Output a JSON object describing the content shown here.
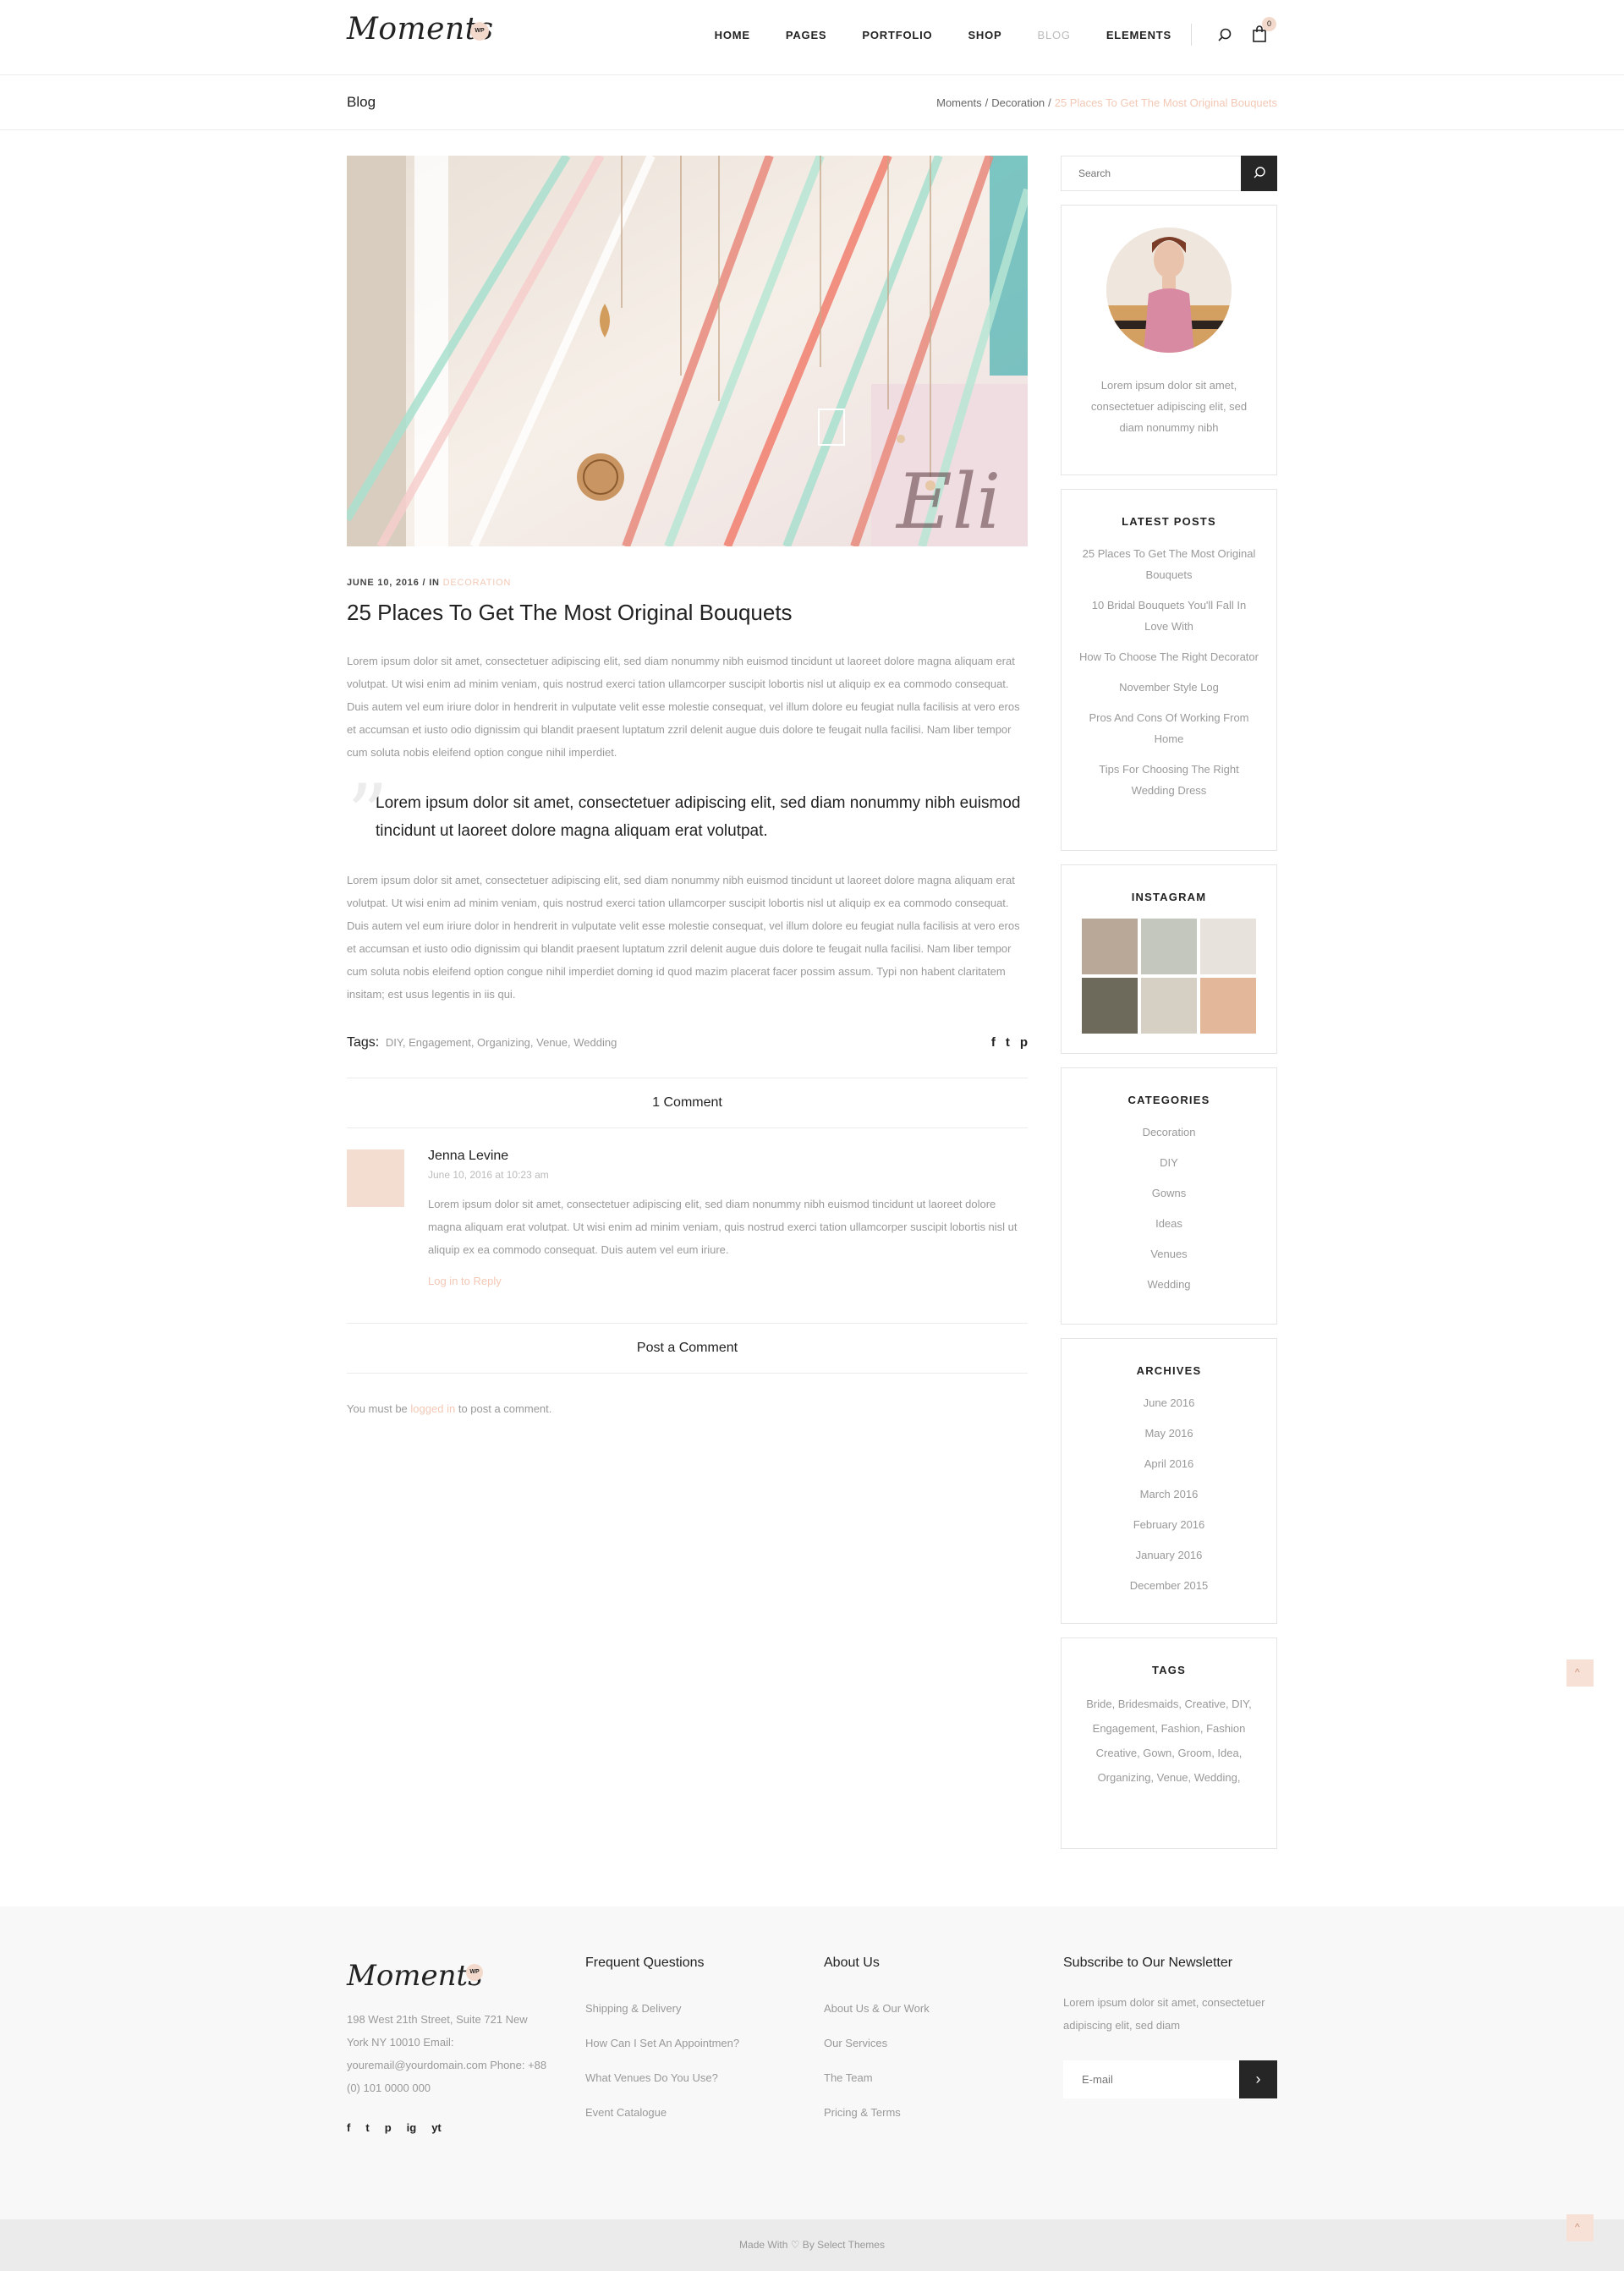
{
  "header": {
    "logo": "Moments",
    "logo_badge": "WP",
    "nav": [
      "HOME",
      "PAGES",
      "PORTFOLIO",
      "SHOP",
      "BLOG",
      "ELEMENTS"
    ],
    "cart_count": "0"
  },
  "titlebar": {
    "title": "Blog",
    "breadcrumb": [
      "Moments",
      "Decoration",
      "25 Places To Get The Most Original Bouquets"
    ]
  },
  "post": {
    "date": "JUNE 10, 2016",
    "in_label": "IN",
    "category": "DECORATION",
    "title": "25 Places To Get The Most Original Bouquets",
    "para1": "Lorem ipsum dolor sit amet, consectetuer adipiscing elit, sed diam nonummy nibh euismod tincidunt ut laoreet dolore magna aliquam erat volutpat. Ut wisi enim ad minim veniam, quis nostrud exerci tation ullamcorper suscipit lobortis nisl ut aliquip ex ea commodo consequat. Duis autem vel eum iriure dolor in hendrerit in vulputate velit esse molestie consequat, vel illum dolore eu feugiat nulla facilisis at vero eros et accumsan et iusto odio dignissim qui blandit praesent luptatum zzril delenit augue duis dolore te feugait nulla facilisi. Nam liber tempor cum soluta nobis eleifend option congue nihil imperdiet.",
    "quote": "Lorem ipsum dolor sit amet, consectetuer adipiscing elit, sed diam nonummy nibh euismod tincidunt ut laoreet dolore magna aliquam erat volutpat.",
    "para2": "Lorem ipsum dolor sit amet, consectetuer adipiscing elit, sed diam nonummy nibh euismod tincidunt ut laoreet dolore magna aliquam erat volutpat. Ut wisi enim ad minim veniam, quis nostrud exerci tation ullamcorper suscipit lobortis nisl ut aliquip ex ea commodo consequat. Duis autem vel eum iriure dolor in hendrerit in vulputate velit esse molestie consequat, vel illum dolore eu feugiat nulla facilisis at vero eros et accumsan et iusto odio dignissim qui blandit praesent luptatum zzril delenit augue duis dolore te feugait nulla facilisi. Nam liber tempor cum soluta nobis eleifend option congue nihil imperdiet doming id quod mazim placerat facer possim assum. Typi non habent claritatem insitam; est usus legentis in iis qui.",
    "tags_label": "Tags:",
    "tags": "DIY, Engagement, Organizing, Venue, Wedding",
    "social": [
      "f",
      "t",
      "p"
    ]
  },
  "comments": {
    "heading": "1 Comment",
    "items": [
      {
        "name": "Jenna Levine",
        "date": "June 10, 2016 at 10:23 am",
        "text": "Lorem ipsum dolor sit amet, consectetuer adipiscing elit, sed diam nonummy nibh euismod tincidunt ut laoreet dolore magna aliquam erat volutpat. Ut wisi enim ad minim veniam, quis nostrud exerci tation ullamcorper suscipit lobortis nisl ut aliquip ex ea commodo consequat. Duis autem vel eum iriure.",
        "reply": "Log in to Reply"
      }
    ],
    "post_heading": "Post a Comment",
    "login_prefix": "You must be",
    "login_link": "logged in",
    "login_suffix": "to post a comment."
  },
  "sidebar": {
    "search_placeholder": "Search",
    "profile_text": "Lorem ipsum dolor sit amet, consectetuer adipiscing elit, sed diam nonummy nibh",
    "latest_title": "LATEST POSTS",
    "latest": [
      "25 Places To Get The Most Original Bouquets",
      "10 Bridal Bouquets You'll Fall In Love With",
      "How To Choose The Right Decorator",
      "November Style Log",
      "Pros And Cons Of Working From Home",
      "Tips For Choosing The Right Wedding Dress"
    ],
    "instagram_title": "INSTAGRAM",
    "instagram_colors": [
      "#b9a898",
      "#c3c7bd",
      "#e7e3dc",
      "#6e6a5b",
      "#d6cfc4",
      "#e2b79a"
    ],
    "categories_title": "CATEGORIES",
    "categories": [
      "Decoration",
      "DIY",
      "Gowns",
      "Ideas",
      "Venues",
      "Wedding"
    ],
    "archives_title": "ARCHIVES",
    "archives": [
      "June 2016",
      "May 2016",
      "April 2016",
      "March 2016",
      "February 2016",
      "January 2016",
      "December 2015"
    ],
    "tags_title": "TAGS",
    "tags": "Bride, Bridesmaids, Creative, DIY, Engagement, Fashion, Fashion Creative, Gown, Groom, Idea, Organizing, Venue, Wedding,"
  },
  "footer": {
    "logo": "Moments",
    "logo_badge": "WP",
    "address": "198 West 21th Street, Suite 721 New York NY 10010 Email: youremail@yourdomain.com Phone: +88 (0) 101 0000 000",
    "social": [
      "f",
      "t",
      "p",
      "ig",
      "yt"
    ],
    "faq_title": "Frequent Questions",
    "faq": [
      "Shipping & Delivery",
      "How Can I Set An Appointmen?",
      "What Venues Do You Use?",
      "Event Catalogue"
    ],
    "about_title": "About Us",
    "about": [
      "About Us & Our Work",
      "Our Services",
      "The Team",
      "Pricing & Terms"
    ],
    "news_title": "Subscribe to Our Newsletter",
    "news_text": "Lorem ipsum dolor sit amet, consectetuer adipiscing elit, sed diam",
    "email_placeholder": "E-mail",
    "bottom": "Made With ♡ By Select Themes"
  },
  "colors": {
    "accent": "#f3c8b5",
    "dark": "#262626",
    "muted": "#999999"
  }
}
